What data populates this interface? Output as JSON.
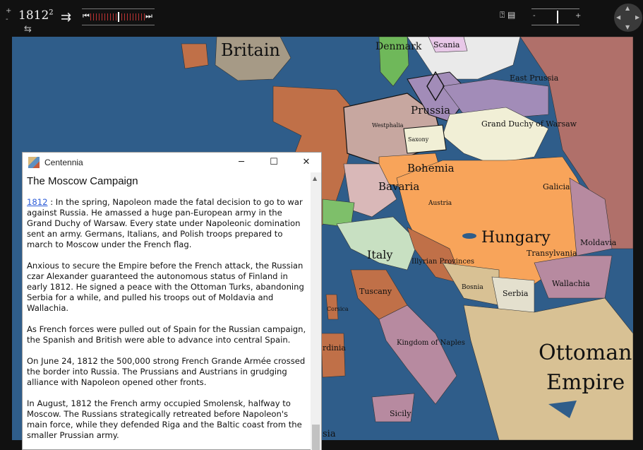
{
  "toolbar": {
    "year": "1812",
    "year_sup": "2",
    "plus": "+",
    "minus": "-",
    "zoom_minus": "-",
    "zoom_plus": "+",
    "timeline_progress": 0.5,
    "icons": [
      "help-icon",
      "layers-icon",
      "swap-icon",
      "shuffle-icon",
      "step-back-icon",
      "play-icon",
      "step-forward-icon",
      "pan-icon"
    ]
  },
  "map": {
    "labels": {
      "britain": "Britain",
      "denmark": "Denmark",
      "scania": "Scania",
      "east_prussia": "East Prussia",
      "prussia": "Prussia",
      "grand_duchy_warsaw": "Grand Duchy of Warsaw",
      "westphalia": "Westphalia",
      "saxony": "Saxony",
      "bohemia": "Bohemia",
      "bavaria": "Bavaria",
      "austria": "Austria",
      "galicia": "Galicia",
      "hungary": "Hungary",
      "transylvania": "Transylvania",
      "moldavia": "Moldavia",
      "wallachia": "Wallachia",
      "italy": "Italy",
      "illyrian_provinces": "Illyrian Provinces",
      "bosnia": "Bosnia",
      "serbia": "Serbia",
      "tuscany": "Tuscany",
      "corsica": "Corsica",
      "sardinia": "rdinia",
      "kingdom_naples": "Kingdom of Naples",
      "ottoman_1": "Ottoman",
      "ottoman_2": "Empire",
      "sicily": "Sicily",
      "sia": "sia"
    }
  },
  "window": {
    "title": "Centennia",
    "minimize": "─",
    "maximize": "☐",
    "close": "✕",
    "heading": "The Moscow Campaign",
    "link": "1812",
    "paragraphs": [
      " : In the spring, Napoleon made the fatal decision to go to war against Russia. He amassed a huge pan-European army in the Grand Duchy of Warsaw. Every state under Napoleonic domination sent an army. Germans, Italians, and Polish troops prepared to march to Moscow under the French flag.",
      "Anxious to secure the Empire before the French attack, the Russian czar Alexander guaranteed the autonomous status of Finland in early 1812. He signed a peace with the Ottoman Turks, abandoning Serbia for a while, and pulled his troops out of Moldavia and Wallachia.",
      "As French forces were pulled out of Spain for the Russian campaign, the Spanish and British were able to advance into central Spain.",
      "On June 24, 1812 the 500,000 strong French Grande Armée crossed the border into Russia. The Prussians and Austrians in grudging alliance with Napoleon opened other fronts.",
      "In August, 1812 the French army occupied Smolensk, halfway to Moscow. The Russians strategically retreated before Napoleon's main force, while they defended Riga and the Baltic coast from the smaller Prussian army."
    ]
  },
  "colors": {
    "sea": "#2f5d8a",
    "britain": "#a69a86",
    "france": "#c07048",
    "prussia": "#a28cb8",
    "warsaw": "#f1efd6",
    "austria": "#f8a45a",
    "bavaria": "#d9b8b8",
    "italy": "#c8e0c2",
    "ottoman": "#d8c194",
    "russia": "#b0706a"
  }
}
